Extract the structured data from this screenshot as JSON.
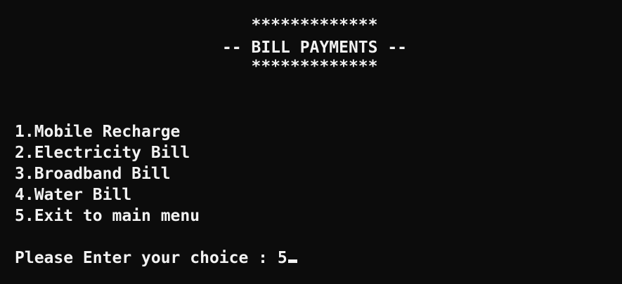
{
  "header": {
    "stars_top": "*************",
    "title": "-- BILL PAYMENTS --",
    "stars_bottom": "*************"
  },
  "menu": {
    "items": [
      {
        "label": "1.Mobile Recharge"
      },
      {
        "label": "2.Electricity Bill"
      },
      {
        "label": "3.Broadband Bill"
      },
      {
        "label": "4.Water Bill"
      },
      {
        "label": "5.Exit to main menu"
      }
    ]
  },
  "prompt": {
    "text": "Please Enter your choice : ",
    "input_value": "5"
  },
  "colors": {
    "background": "#0c0c0c",
    "foreground": "#f2f2f2"
  }
}
